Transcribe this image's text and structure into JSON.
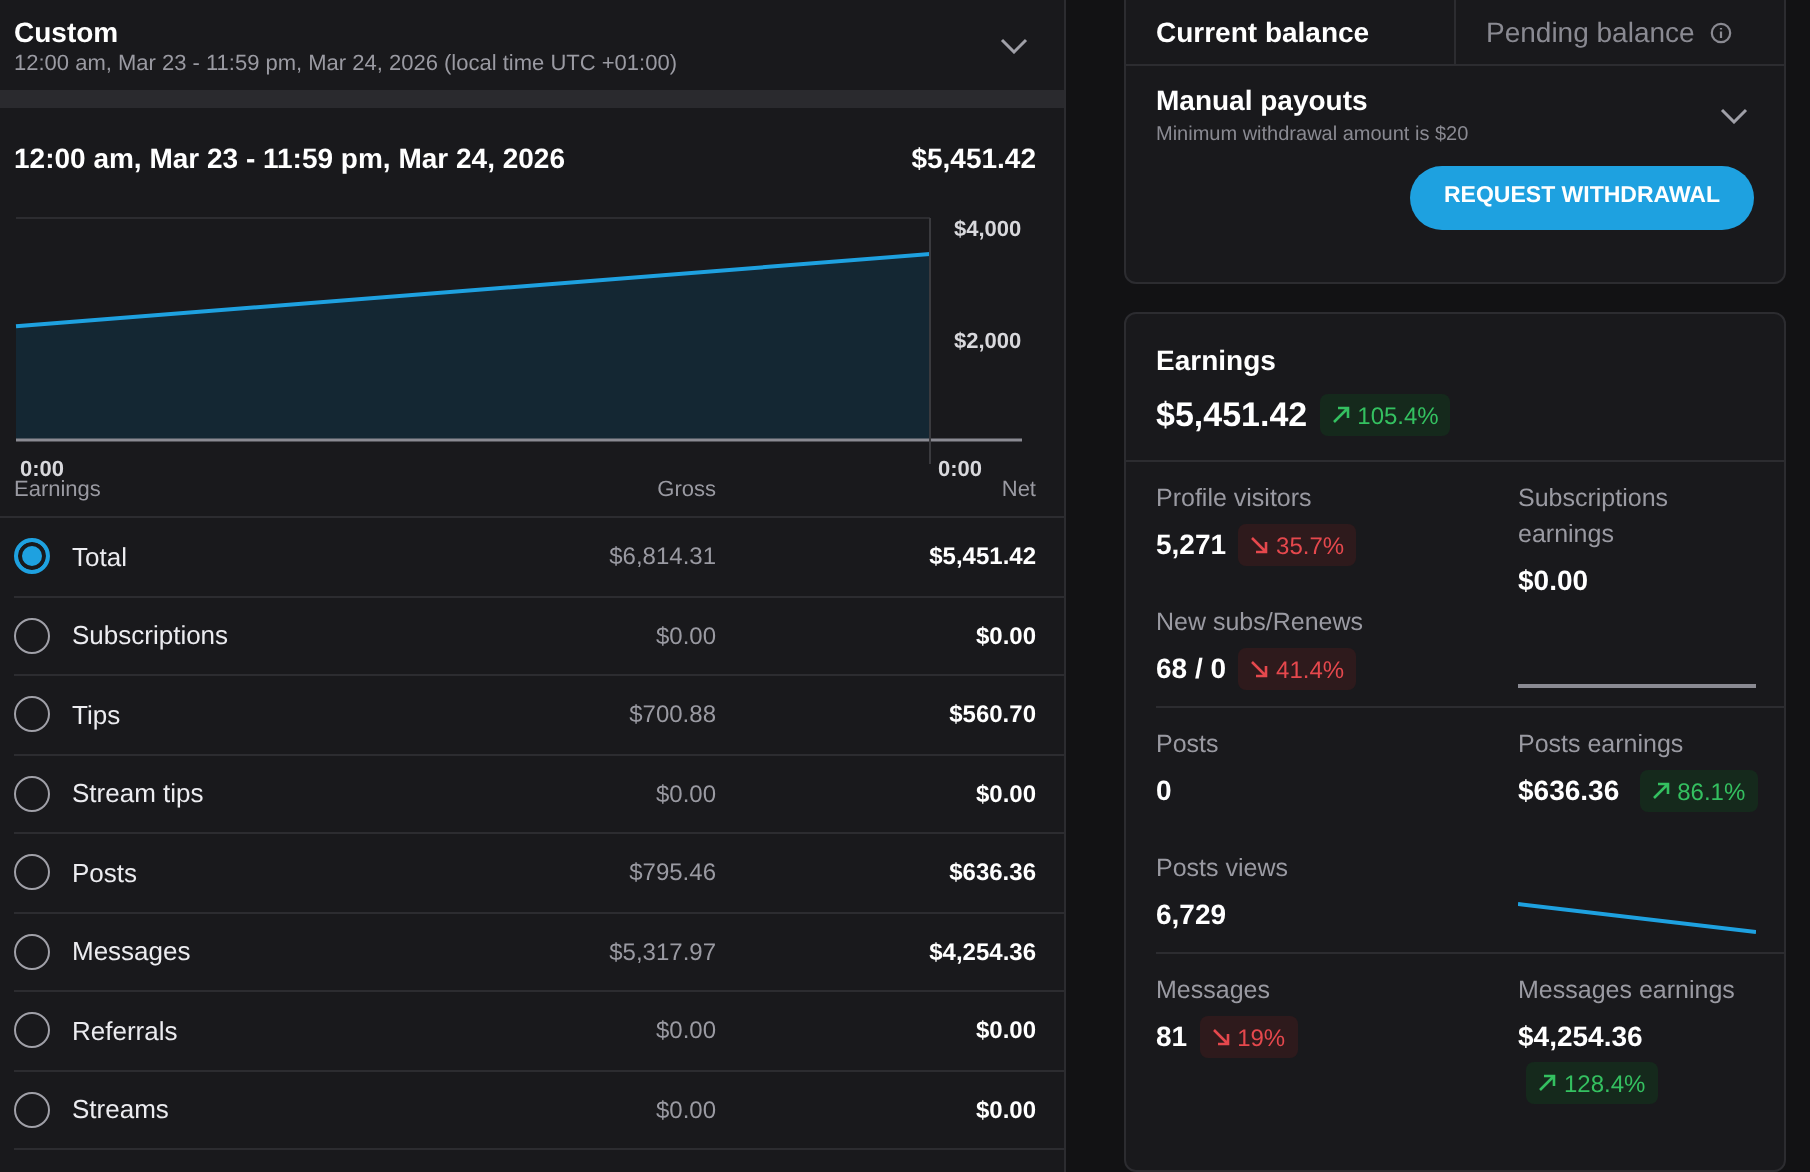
{
  "period": {
    "title": "Custom",
    "subtitle": "12:00 am, Mar 23 - 11:59 pm, Mar 24, 2026 (local time UTC +01:00)"
  },
  "summary": {
    "range": "12:00 am, Mar 23 - 11:59 pm, Mar 24, 2026",
    "total": "$5,451.42",
    "chart_data": {
      "type": "area",
      "categories": [
        "0:00",
        "0:00"
      ],
      "series": [
        {
          "color": "#1ea1e0",
          "values": [
            2050,
            3350
          ]
        }
      ],
      "ylim": [
        0,
        4000
      ],
      "yticks": [
        {
          "value": 2000,
          "label": "$2,000"
        },
        {
          "value": 4000,
          "label": "$4,000"
        }
      ]
    }
  },
  "table": {
    "columns": [
      "Earnings",
      "Gross",
      "Net"
    ],
    "rows": [
      {
        "label": "Total",
        "gross": "$6,814.31",
        "net": "$5,451.42",
        "selected": true
      },
      {
        "label": "Subscriptions",
        "gross": "$0.00",
        "net": "$0.00",
        "selected": false
      },
      {
        "label": "Tips",
        "gross": "$700.88",
        "net": "$560.70",
        "selected": false
      },
      {
        "label": "Stream tips",
        "gross": "$0.00",
        "net": "$0.00",
        "selected": false
      },
      {
        "label": "Posts",
        "gross": "$795.46",
        "net": "$636.36",
        "selected": false
      },
      {
        "label": "Messages",
        "gross": "$5,317.97",
        "net": "$4,254.36",
        "selected": false
      },
      {
        "label": "Referrals",
        "gross": "$0.00",
        "net": "$0.00",
        "selected": false
      },
      {
        "label": "Streams",
        "gross": "$0.00",
        "net": "$0.00",
        "selected": false
      }
    ]
  },
  "balance": {
    "tabs": [
      {
        "label": "Current balance",
        "selected": true
      },
      {
        "label": "Pending balance",
        "selected": false
      }
    ],
    "payouts_title": "Manual payouts",
    "payouts_note": "Minimum withdrawal amount is $20",
    "button": "REQUEST WITHDRAWAL"
  },
  "earnings": {
    "title": "Earnings",
    "value": "$5,451.42",
    "change": {
      "text": "105.4%",
      "increase": true
    },
    "sections": [
      {
        "left": [
          {
            "label": "Profile visitors",
            "value": "5,271",
            "change": {
              "text": "35.7%",
              "increase": false
            }
          },
          {
            "label": "New subs/Renews",
            "value": "68 / 0",
            "change": {
              "text": "41.4%",
              "increase": false
            }
          }
        ],
        "right": {
          "kind": "flat",
          "label": "Subscriptions earnings",
          "value": "$0.00"
        }
      },
      {
        "left": [
          {
            "label": "Posts",
            "value": "0"
          },
          {
            "label": "Posts views",
            "value": "6,729"
          }
        ],
        "right": {
          "kind": "falling",
          "label": "Posts earnings",
          "value": "$636.36",
          "change": {
            "text": "86.1%",
            "increase": true
          }
        }
      },
      {
        "left": [
          {
            "label": "Messages",
            "value": "81",
            "change": {
              "text": "19%",
              "increase": false
            }
          }
        ],
        "right": {
          "kind": "plain",
          "label": "Messages earnings",
          "value": "$4,254.36",
          "change": {
            "text": "128.4%",
            "increase": true
          }
        }
      }
    ]
  }
}
